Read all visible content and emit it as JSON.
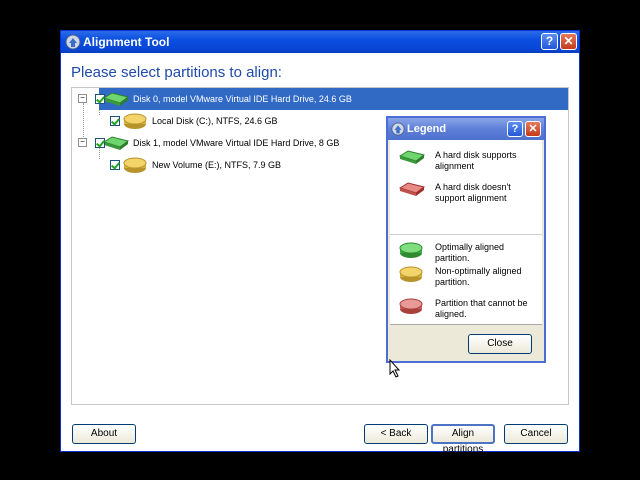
{
  "window": {
    "title": "Alignment Tool"
  },
  "heading": "Please select partitions to align:",
  "tree": {
    "disks": [
      {
        "label": "Disk 0, model VMware Virtual IDE Hard Drive, 24.6 GB",
        "partitions": [
          "Local Disk (C:), NTFS, 24.6 GB"
        ]
      },
      {
        "label": "Disk 1, model VMware Virtual IDE Hard Drive, 8 GB",
        "partitions": [
          "New Volume (E:), NTFS, 7.9 GB"
        ]
      }
    ]
  },
  "buttons": {
    "about": "About",
    "back": "< Back",
    "align": "Align partitions",
    "cancel": "Cancel"
  },
  "titlebar_buttons": {
    "help": "?",
    "close": "✕"
  },
  "legend": {
    "title": "Legend",
    "help": "?",
    "close_x": "✕",
    "items": [
      "A hard disk supports alignment",
      "A hard disk doesn't support alignment",
      "Optimally aligned partition.",
      "Non-optimally aligned partition.",
      "Partition that cannot be aligned."
    ],
    "close_button": "Close"
  },
  "colors": {
    "title_blue": "#0a4ee0",
    "heading_blue": "#1f4aa8",
    "selection": "#316ac5",
    "green": "#3cb043",
    "red": "#d9534f",
    "yellow": "#d9b43a"
  }
}
